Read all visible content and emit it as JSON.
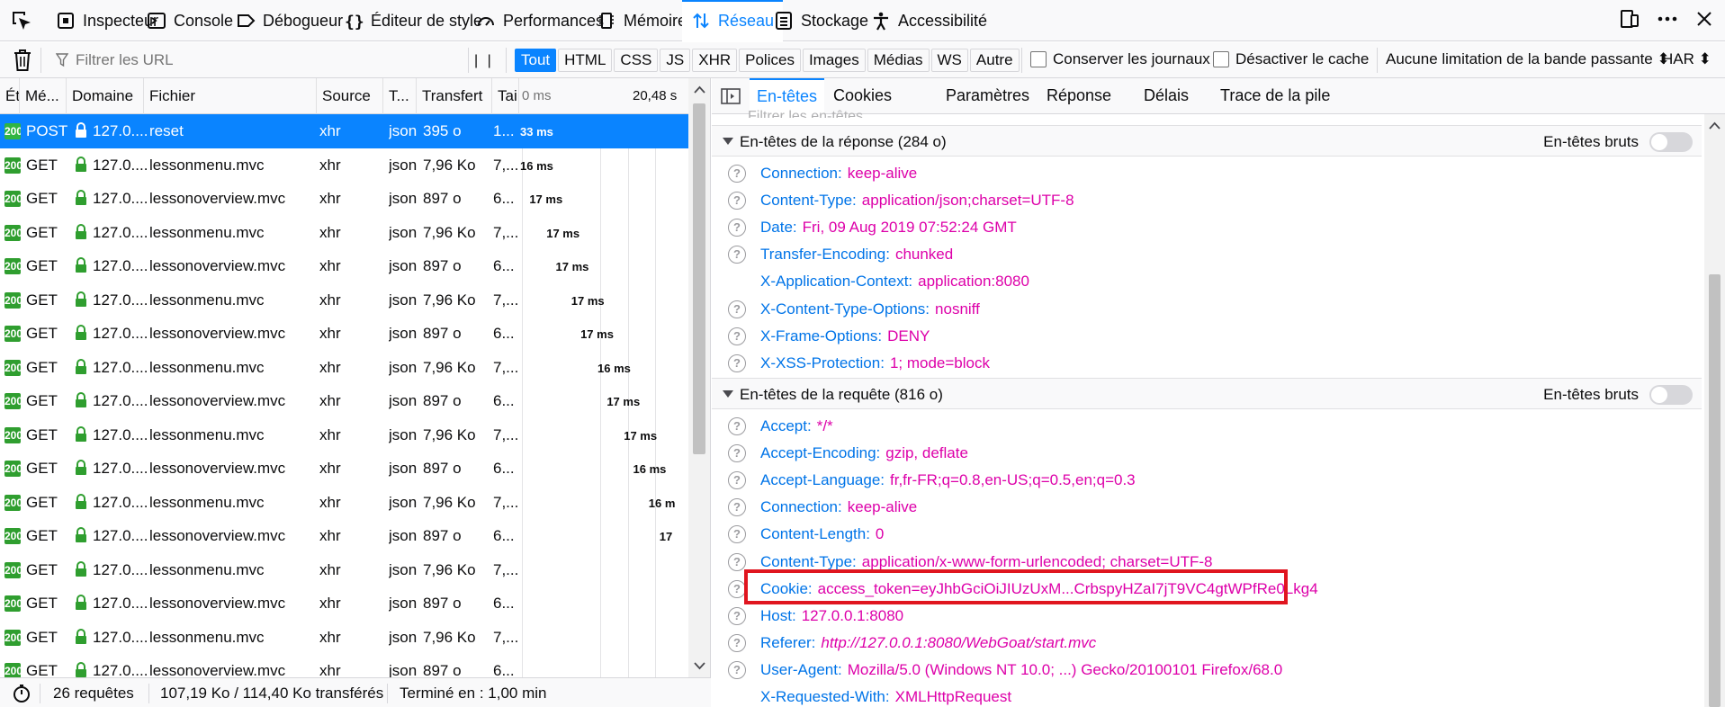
{
  "toolbox": {
    "tabs": [
      {
        "label": "Inspecteur",
        "icon": "inspector-icon"
      },
      {
        "label": "Console",
        "icon": "console-icon"
      },
      {
        "label": "Débogueur",
        "icon": "debugger-icon"
      },
      {
        "label": "Éditeur de style",
        "icon": "style-editor-icon"
      },
      {
        "label": "Performances",
        "icon": "performance-icon"
      },
      {
        "label": "Mémoire",
        "icon": "memory-icon"
      },
      {
        "label": "Réseau",
        "icon": "network-icon",
        "active": true
      },
      {
        "label": "Stockage",
        "icon": "storage-icon"
      },
      {
        "label": "Accessibilité",
        "icon": "accessibility-icon"
      }
    ]
  },
  "nettoolbar": {
    "filter_placeholder": "Filtrer les URL",
    "type_filters": [
      "Tout",
      "HTML",
      "CSS",
      "JS",
      "XHR",
      "Polices",
      "Images",
      "Médias",
      "WS",
      "Autre"
    ],
    "active_filter": "Tout",
    "persist_logs": "Conserver les journaux",
    "disable_cache": "Désactiver le cache",
    "throttling": "Aucune limitation de la bande passante ⬍",
    "har": "HAR ⬍"
  },
  "reqlist": {
    "columns": {
      "status": "Ét",
      "method": "Mé...",
      "domain": "Domaine",
      "file": "Fichier",
      "source": "Source",
      "type": "T...",
      "transfer": "Transfert",
      "size": "Tai",
      "wf_start": "0 ms",
      "wf_end": "20,48 s"
    },
    "rows": [
      {
        "status": "200",
        "method": "POST",
        "domain": "127.0....",
        "file": "reset",
        "source": "xhr",
        "type": "json",
        "transfer": "395 o",
        "size": "1...",
        "timing": "33 ms",
        "offset": 0.0,
        "selected": true
      },
      {
        "status": "200",
        "method": "GET",
        "domain": "127.0....",
        "file": "lessonmenu.mvc",
        "source": "xhr",
        "type": "json",
        "transfer": "7,96 Ko",
        "size": "7,...",
        "timing": "16 ms",
        "offset": 0.0
      },
      {
        "status": "200",
        "method": "GET",
        "domain": "127.0....",
        "file": "lessonoverview.mvc",
        "source": "xhr",
        "type": "json",
        "transfer": "897 o",
        "size": "6...",
        "timing": "17 ms",
        "offset": 0.06
      },
      {
        "status": "200",
        "method": "GET",
        "domain": "127.0....",
        "file": "lessonmenu.mvc",
        "source": "xhr",
        "type": "json",
        "transfer": "7,96 Ko",
        "size": "7,...",
        "timing": "17 ms",
        "offset": 0.17
      },
      {
        "status": "200",
        "method": "GET",
        "domain": "127.0....",
        "file": "lessonoverview.mvc",
        "source": "xhr",
        "type": "json",
        "transfer": "897 o",
        "size": "6...",
        "timing": "17 ms",
        "offset": 0.23
      },
      {
        "status": "200",
        "method": "GET",
        "domain": "127.0....",
        "file": "lessonmenu.mvc",
        "source": "xhr",
        "type": "json",
        "transfer": "7,96 Ko",
        "size": "7,...",
        "timing": "17 ms",
        "offset": 0.33
      },
      {
        "status": "200",
        "method": "GET",
        "domain": "127.0....",
        "file": "lessonoverview.mvc",
        "source": "xhr",
        "type": "json",
        "transfer": "897 o",
        "size": "6...",
        "timing": "17 ms",
        "offset": 0.39
      },
      {
        "status": "200",
        "method": "GET",
        "domain": "127.0....",
        "file": "lessonmenu.mvc",
        "source": "xhr",
        "type": "json",
        "transfer": "7,96 Ko",
        "size": "7,...",
        "timing": "16 ms",
        "offset": 0.5
      },
      {
        "status": "200",
        "method": "GET",
        "domain": "127.0....",
        "file": "lessonoverview.mvc",
        "source": "xhr",
        "type": "json",
        "transfer": "897 o",
        "size": "6...",
        "timing": "17 ms",
        "offset": 0.56
      },
      {
        "status": "200",
        "method": "GET",
        "domain": "127.0....",
        "file": "lessonmenu.mvc",
        "source": "xhr",
        "type": "json",
        "transfer": "7,96 Ko",
        "size": "7,...",
        "timing": "17 ms",
        "offset": 0.67
      },
      {
        "status": "200",
        "method": "GET",
        "domain": "127.0....",
        "file": "lessonoverview.mvc",
        "source": "xhr",
        "type": "json",
        "transfer": "897 o",
        "size": "6...",
        "timing": "16 ms",
        "offset": 0.73
      },
      {
        "status": "200",
        "method": "GET",
        "domain": "127.0....",
        "file": "lessonmenu.mvc",
        "source": "xhr",
        "type": "json",
        "transfer": "7,96 Ko",
        "size": "7,...",
        "timing": "16 m",
        "offset": 0.83
      },
      {
        "status": "200",
        "method": "GET",
        "domain": "127.0....",
        "file": "lessonoverview.mvc",
        "source": "xhr",
        "type": "json",
        "transfer": "897 o",
        "size": "6...",
        "timing": "17",
        "offset": 0.9
      },
      {
        "status": "200",
        "method": "GET",
        "domain": "127.0....",
        "file": "lessonmenu.mvc",
        "source": "xhr",
        "type": "json",
        "transfer": "7,96 Ko",
        "size": "7,...",
        "timing": "",
        "offset": 1.0
      },
      {
        "status": "200",
        "method": "GET",
        "domain": "127.0....",
        "file": "lessonoverview.mvc",
        "source": "xhr",
        "type": "json",
        "transfer": "897 o",
        "size": "6...",
        "timing": "",
        "offset": 1.0
      },
      {
        "status": "200",
        "method": "GET",
        "domain": "127.0....",
        "file": "lessonmenu.mvc",
        "source": "xhr",
        "type": "json",
        "transfer": "7,96 Ko",
        "size": "7,...",
        "timing": "",
        "offset": 1.0
      },
      {
        "status": "200",
        "method": "GET",
        "domain": "127.0....",
        "file": "lessonoverview.mvc",
        "source": "xhr",
        "type": "json",
        "transfer": "897 o",
        "size": "6...",
        "timing": "",
        "offset": 1.0
      }
    ]
  },
  "details": {
    "tabs": [
      "En-têtes",
      "Cookies",
      "Paramètres",
      "Réponse",
      "Délais",
      "Trace de la pile"
    ],
    "active_tab": "En-têtes",
    "filter_placeholder": "Filtrer les en-têtes",
    "raw_label": "En-têtes bruts",
    "response_section": "En-têtes de la réponse (284 o)",
    "request_section": "En-têtes de la requête (816 o)",
    "response_headers": [
      {
        "name": "Connection:",
        "value": "keep-alive",
        "help": true
      },
      {
        "name": "Content-Type:",
        "value": "application/json;charset=UTF-8",
        "help": true
      },
      {
        "name": "Date:",
        "value": "Fri, 09 Aug 2019 07:52:24 GMT",
        "help": true
      },
      {
        "name": "Transfer-Encoding:",
        "value": "chunked",
        "help": true
      },
      {
        "name": "X-Application-Context:",
        "value": "application:8080",
        "help": false
      },
      {
        "name": "X-Content-Type-Options:",
        "value": "nosniff",
        "help": true
      },
      {
        "name": "X-Frame-Options:",
        "value": "DENY",
        "help": true
      },
      {
        "name": "X-XSS-Protection:",
        "value": "1; mode=block",
        "help": true
      }
    ],
    "request_headers": [
      {
        "name": "Accept:",
        "value": "*/*",
        "help": true
      },
      {
        "name": "Accept-Encoding:",
        "value": "gzip, deflate",
        "help": true
      },
      {
        "name": "Accept-Language:",
        "value": "fr,fr-FR;q=0.8,en-US;q=0.5,en;q=0.3",
        "help": true
      },
      {
        "name": "Connection:",
        "value": "keep-alive",
        "help": true
      },
      {
        "name": "Content-Length:",
        "value": "0",
        "help": true
      },
      {
        "name": "Content-Type:",
        "value": "application/x-www-form-urlencoded; charset=UTF-8",
        "help": true
      },
      {
        "name": "Cookie:",
        "value": "access_token=eyJhbGciOiJIUzUxM...CrbspyHZaI7jT9VC4gtWPfRe0Lkg4",
        "help": true,
        "highlight": true
      },
      {
        "name": "Host:",
        "value": "127.0.0.1:8080",
        "help": true
      },
      {
        "name": "Referer:",
        "value": "http://127.0.0.1:8080/WebGoat/start.mvc",
        "help": true,
        "italic": true
      },
      {
        "name": "User-Agent:",
        "value": "Mozilla/5.0 (Windows NT 10.0; ...) Gecko/20100101 Firefox/68.0",
        "help": true
      },
      {
        "name": "X-Requested-With:",
        "value": "XMLHttpRequest",
        "help": false
      }
    ]
  },
  "statusbar": {
    "requests": "26 requêtes",
    "transferred": "107,19 Ko / 114,40 Ko transférés",
    "finished": "Terminé en : 1,00 min"
  },
  "colors": {
    "accent": "#0a84ff",
    "header_name": "#0074e8",
    "header_value": "#dd00a9",
    "status_ok": "#2f9e2f",
    "highlight_box": "#e0151f"
  }
}
